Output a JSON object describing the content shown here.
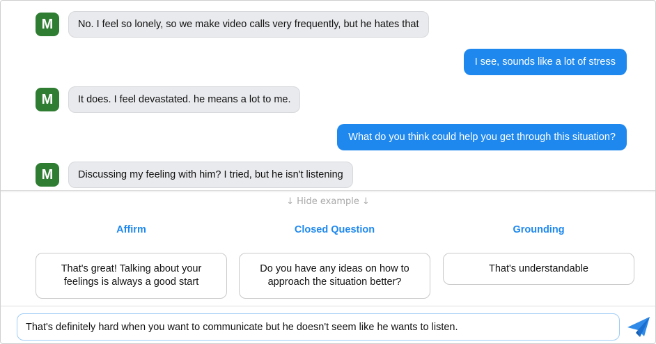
{
  "chat": {
    "messages": [
      {
        "from": "client",
        "avatar": "M",
        "text": "No. I feel so lonely, so we make video calls very frequently, but he hates that"
      },
      {
        "from": "user",
        "text": "I see, sounds like a lot of stress"
      },
      {
        "from": "client",
        "avatar": "M",
        "text": "It does. I feel devastated. he means a lot to me."
      },
      {
        "from": "user",
        "text": "What do you think could help you get through this situation?"
      },
      {
        "from": "client",
        "avatar": "M",
        "text": "Discussing my feeling with him? I tried, but he isn't listening"
      }
    ]
  },
  "suggestions": {
    "toggle_label": "↓ Hide example ↓",
    "columns": [
      {
        "title": "Affirm",
        "example": "That's great! Talking about your feelings is always a good start"
      },
      {
        "title": "Closed Question",
        "example": "Do you have any ideas on how to approach the situation better?"
      },
      {
        "title": "Grounding",
        "example": "That's understandable"
      }
    ]
  },
  "composer": {
    "value": "That's definitely hard when you want to communicate but he doesn't seem like he wants to listen.",
    "send_icon": "paper-plane-icon",
    "accent_color": "#1e88ee"
  },
  "colors": {
    "avatar_bg": "#2e7d32",
    "user_bubble": "#1e88ee",
    "client_bubble": "#e9eaed"
  }
}
